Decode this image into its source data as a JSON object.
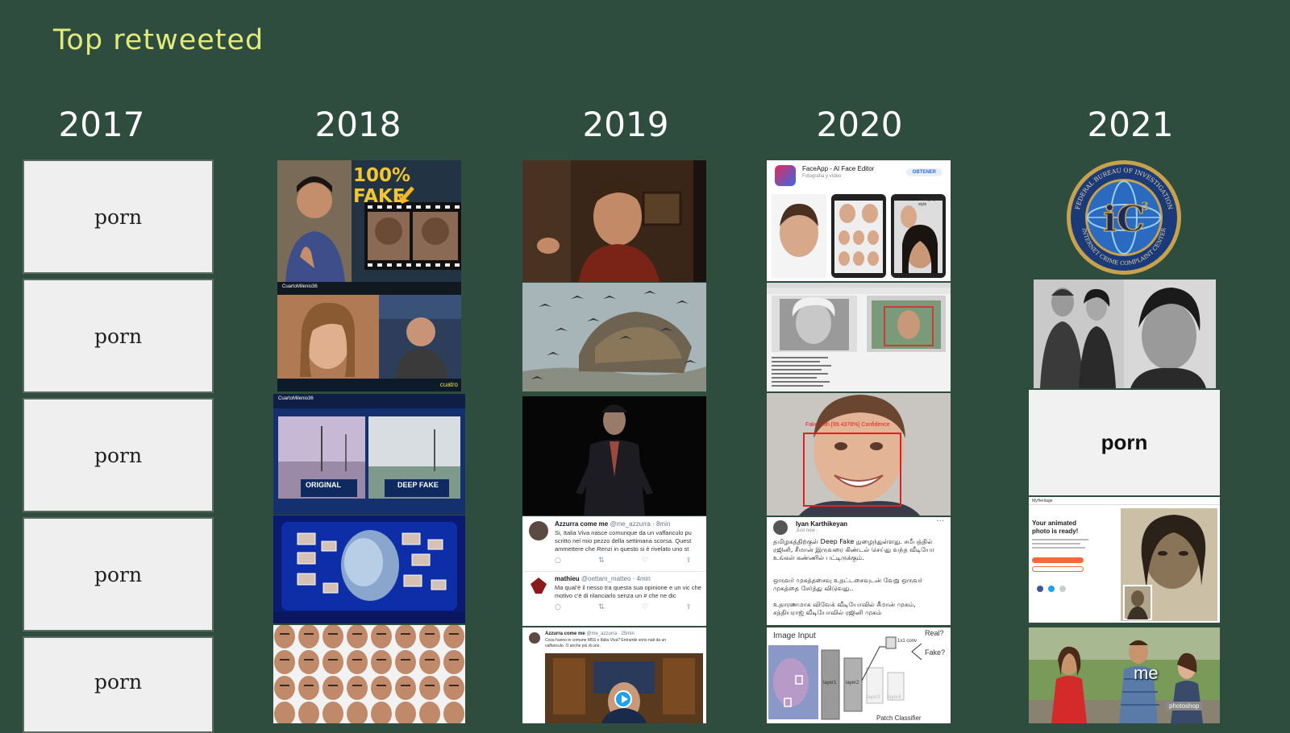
{
  "slide": {
    "title": "Top retweeted"
  },
  "years": [
    "2017",
    "2018",
    "2019",
    "2020",
    "2021"
  ],
  "col2017": {
    "labels": [
      "porn",
      "porn",
      "porn",
      "porn",
      "porn"
    ]
  },
  "col2018": {
    "fake_banner": "100% FAKE",
    "channel_tag": "CuartoMilenio36",
    "channel_tag2": "CuartoMilenio36",
    "cuatro_tag": "cuatro",
    "original_label": "ORIGINAL",
    "deepfake_label": "DEEP FAKE"
  },
  "col2019": {
    "tweet1": {
      "author": "Azzurra come me",
      "handle": "@me_azzurra · 8min",
      "text": "Si, Italia Viva nasce comunque da un vaffanculo pu scritto nel mio pezzo della settimana scorsa. Quest ammettere che Renzi in questo si è rivelato uno st"
    },
    "tweet2": {
      "author": "mathieu",
      "handle": "@oettam_matteo · 4min",
      "text": "Ma qual'è il nesso tra questa sua opinione e un vic che motivo c'è di rilanciarlo senza un # che ne dic"
    },
    "tweet3": {
      "author": "Azzurra come me",
      "handle": "@me_azzurra · 25min",
      "text": "Cosa hanno in comune M5S e Italia Viva? Entrambi sono nati da un vaffanculo. O anche più di uno."
    }
  },
  "col2020": {
    "app_name": "FaceApp - AI Face Editor",
    "app_category": "Fotografía y vídeo",
    "app_button": "OBTENER",
    "app_side": "Change your style",
    "confidence": "Fake with [99.4378%] Confidence",
    "tamil_author": "Iyan Karthikeyan",
    "tamil_time": "Just now · ",
    "tamil_p1": "தமிழகத்திற்குள் Deep Fake நுழைந்துள்ளது. சமீபத்தில் ரஜினி, சீமான் இருவரை கிண்டல் செய்து வந்த வீடியோ உங்கள் கண்ணில் பட்டிருக்கும்.",
    "tamil_p2": "ஒருவர் முகத்தசைவு உதட்டசைவுடன் வேறு ஒருவர் முகத்தை சேர்த்து விடுவது..",
    "tamil_p3": "உதாரணமாக விவேக் வீடியோவில் சீமான் முகம், சத்தியராஜ் வீடியோவில் ரஜினி முகம்",
    "diagram": {
      "input_label": "Image Input",
      "layer1": "layer1",
      "layer2": "layer2",
      "layer3": "layer3",
      "layer4": "layer4",
      "conv": "1x1 conv",
      "real": "Real?",
      "fake": "Fake?",
      "patch": "Patch Classifier"
    }
  },
  "col2021": {
    "seal_text_top": "FEDERAL BUREAU OF INVESTIGATION",
    "seal_text_bottom": "INTERNET CRIME COMPLAINT CENTER",
    "seal_center": "IC3",
    "porn_label": "porn",
    "mh_brand": "MyHeritage",
    "mh_headline": "Your animated photo is ready!",
    "meme_me": "me",
    "meme_photoshop": "photoshop"
  },
  "colors": {
    "background": "#2e4d3e",
    "title": "#e2ea7a",
    "year": "#ffffff",
    "placeholder": "#efefef"
  }
}
